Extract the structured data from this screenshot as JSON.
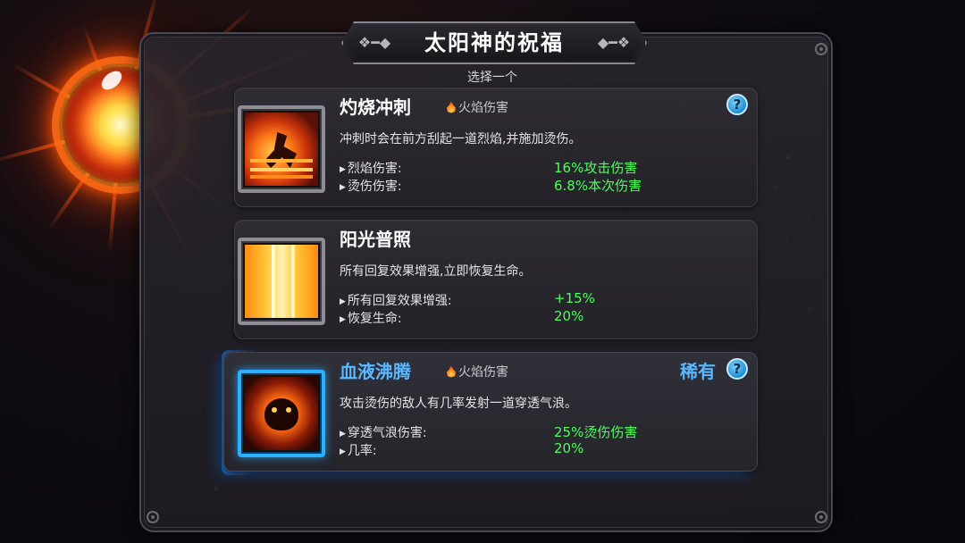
{
  "title": "太阳神的祝福",
  "subtitle": "选择一个",
  "cards": [
    {
      "name": "灼烧冲刺",
      "tag": "火焰伤害",
      "help": "?",
      "rarity": "",
      "description": "冲刺时会在前方刮起一道烈焰,并施加烫伤。",
      "stats": [
        {
          "label": "烈焰伤害:",
          "value": "16%攻击伤害"
        },
        {
          "label": "烫伤伤害:",
          "value": "6.8%本次伤害"
        }
      ],
      "icon": "flame-dash-icon"
    },
    {
      "name": "阳光普照",
      "tag": "",
      "help": "",
      "rarity": "",
      "description": "所有回复效果增强,立即恢复生命。",
      "stats": [
        {
          "label": "所有回复效果增强:",
          "value": "+15%"
        },
        {
          "label": "恢复生命:",
          "value": "20%"
        }
      ],
      "icon": "sun-beam-icon"
    },
    {
      "name": "血液沸腾",
      "tag": "火焰伤害",
      "help": "?",
      "rarity": "稀有",
      "description": "攻击烫伤的敌人有几率发射一道穿透气浪。",
      "stats": [
        {
          "label": "穿透气浪伤害:",
          "value": "25%烫伤伤害"
        },
        {
          "label": "几率:",
          "value": "20%"
        }
      ],
      "icon": "demon-vortex-icon"
    }
  ],
  "colors": {
    "stat_value": "#4cff5a",
    "rare_accent": "#59b8ff",
    "panel_bg": "#28242c"
  }
}
